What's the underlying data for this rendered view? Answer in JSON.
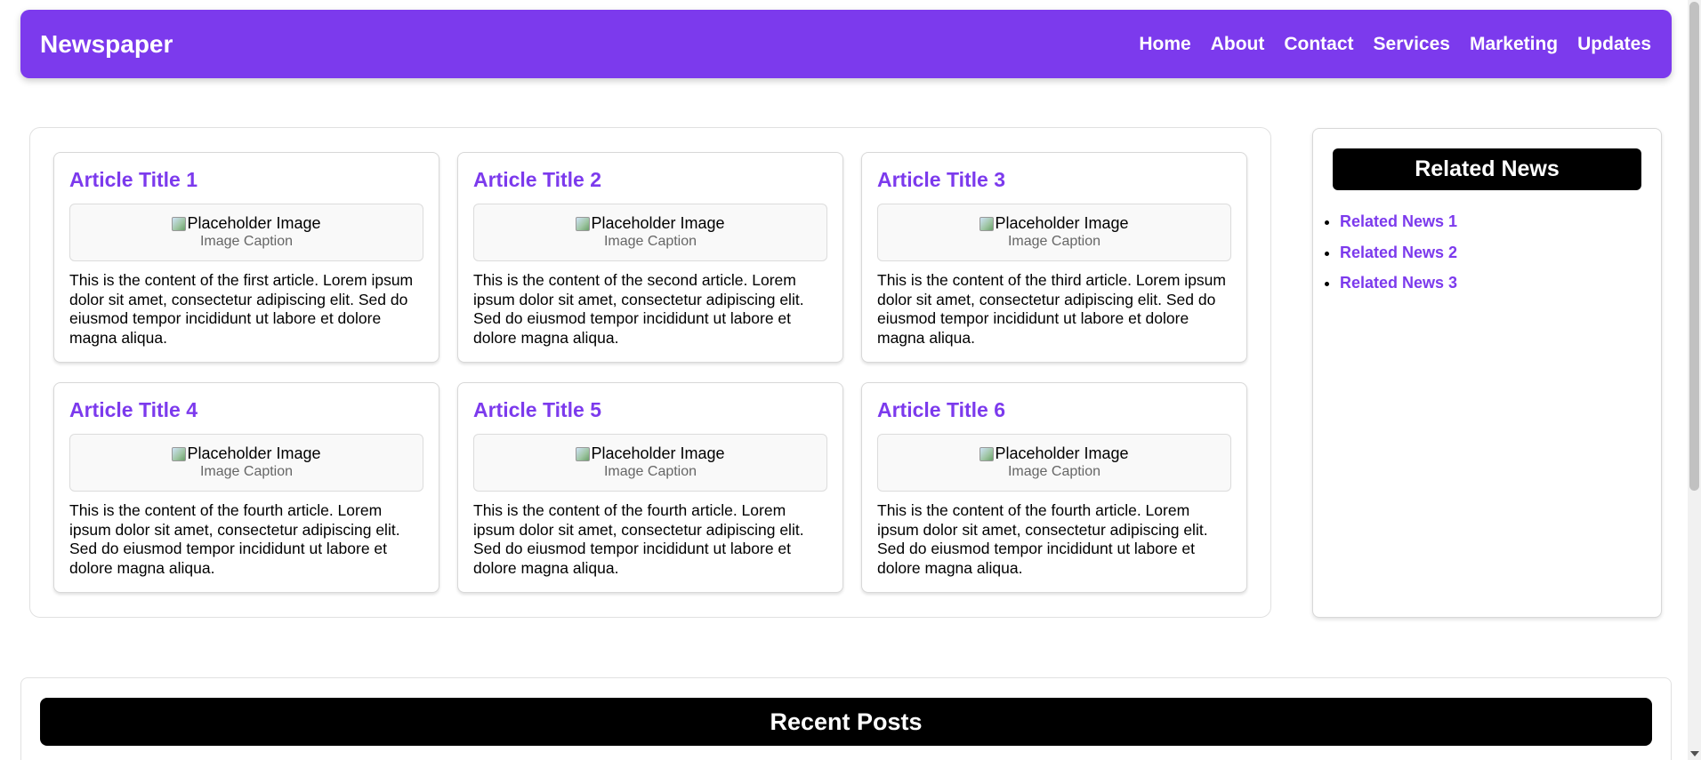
{
  "header": {
    "brand": "Newspaper",
    "nav": [
      "Home",
      "About",
      "Contact",
      "Services",
      "Marketing",
      "Updates"
    ]
  },
  "articles": [
    {
      "title": "Article Title 1",
      "image_alt": "Placeholder Image",
      "caption": "Image Caption",
      "content": "This is the content of the first article. Lorem ipsum dolor sit amet, consectetur adipiscing elit. Sed do eiusmod tempor incididunt ut labore et dolore magna aliqua."
    },
    {
      "title": "Article Title 2",
      "image_alt": "Placeholder Image",
      "caption": "Image Caption",
      "content": "This is the content of the second article. Lorem ipsum dolor sit amet, consectetur adipiscing elit. Sed do eiusmod tempor incididunt ut labore et dolore magna aliqua."
    },
    {
      "title": "Article Title 3",
      "image_alt": "Placeholder Image",
      "caption": "Image Caption",
      "content": "This is the content of the third article. Lorem ipsum dolor sit amet, consectetur adipiscing elit. Sed do eiusmod tempor incididunt ut labore et dolore magna aliqua."
    },
    {
      "title": "Article Title 4",
      "image_alt": "Placeholder Image",
      "caption": "Image Caption",
      "content": "This is the content of the fourth article. Lorem ipsum dolor sit amet, consectetur adipiscing elit. Sed do eiusmod tempor incididunt ut labore et dolore magna aliqua."
    },
    {
      "title": "Article Title 5",
      "image_alt": "Placeholder Image",
      "caption": "Image Caption",
      "content": "This is the content of the fourth article. Lorem ipsum dolor sit amet, consectetur adipiscing elit. Sed do eiusmod tempor incididunt ut labore et dolore magna aliqua."
    },
    {
      "title": "Article Title 6",
      "image_alt": "Placeholder Image",
      "caption": "Image Caption",
      "content": "This is the content of the fourth article. Lorem ipsum dolor sit amet, consectetur adipiscing elit. Sed do eiusmod tempor incididunt ut labore et dolore magna aliqua."
    }
  ],
  "sidebar": {
    "title": "Related News",
    "items": [
      "Related News 1",
      "Related News 2",
      "Related News 3"
    ]
  },
  "recent": {
    "title": "Recent Posts"
  },
  "colors": {
    "accent": "#7c3aed",
    "title_bar": "#000000"
  }
}
